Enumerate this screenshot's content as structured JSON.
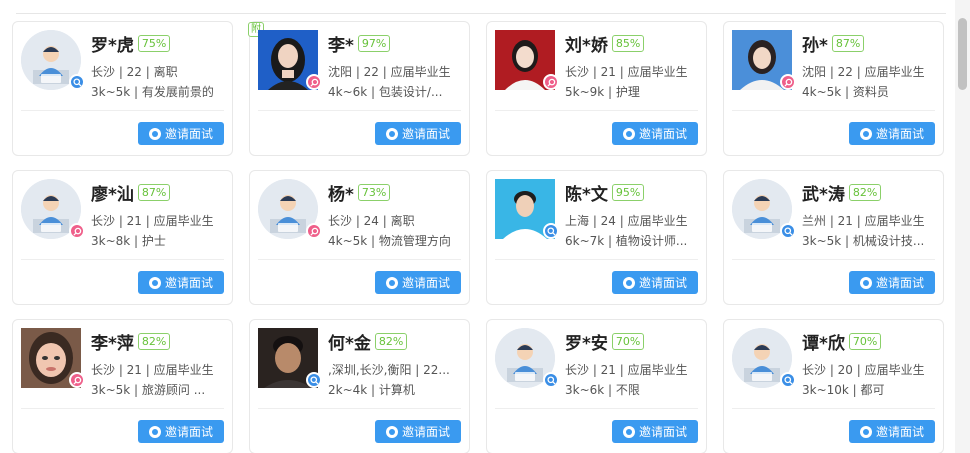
{
  "invite_label": "邀请面试",
  "attachment_label": "附",
  "colors": {
    "accent": "#3a9af0",
    "match_green": "#67c23a",
    "status_blue": "#3a8ee6",
    "status_pink": "#ef5f8a"
  },
  "candidates": [
    {
      "name": "罗*虎",
      "match": "75%",
      "info": "长沙 | 22 | 离职",
      "detail": "3k~5k | 有发展前景的",
      "avatar": "default",
      "status": "blue",
      "attachment": false
    },
    {
      "name": "李*",
      "match": "97%",
      "info": "沈阳 | 22 | 应届毕业生",
      "detail": "4k~6k | 包装设计/...",
      "avatar": "photo-woman-dark-hair-blue-bg",
      "status": "pink",
      "attachment": true
    },
    {
      "name": "刘*娇",
      "match": "85%",
      "info": "长沙 | 21 | 应届毕业生",
      "detail": "5k~9k | 护理",
      "avatar": "photo-woman-red-bg",
      "status": "pink",
      "attachment": false
    },
    {
      "name": "孙*",
      "match": "87%",
      "info": "沈阳 | 22 | 应届毕业生",
      "detail": "4k~5k | 资料员",
      "avatar": "photo-woman-blue-bg",
      "status": "pink",
      "attachment": false
    },
    {
      "name": "廖*汕",
      "match": "87%",
      "info": "长沙 | 21 | 应届毕业生",
      "detail": "3k~8k | 护士",
      "avatar": "default",
      "status": "pink",
      "attachment": false
    },
    {
      "name": "杨*",
      "match": "73%",
      "info": "长沙 | 24 | 离职",
      "detail": "4k~5k | 物流管理方向",
      "avatar": "default",
      "status": "pink",
      "attachment": false
    },
    {
      "name": "陈*文",
      "match": "95%",
      "info": "上海 | 24 | 应届毕业生",
      "detail": "6k~7k | 植物设计师...",
      "avatar": "photo-man-cyan-bg",
      "status": "blue",
      "attachment": false
    },
    {
      "name": "武*涛",
      "match": "82%",
      "info": "兰州 | 21 | 应届毕业生",
      "detail": "3k~5k | 机械设计技...",
      "avatar": "default",
      "status": "blue",
      "attachment": false
    },
    {
      "name": "李*萍",
      "match": "82%",
      "info": "长沙 | 21 | 应届毕业生",
      "detail": "3k~5k | 旅游顾问 ...",
      "avatar": "photo-woman-face",
      "status": "pink",
      "attachment": false
    },
    {
      "name": "何*金",
      "match": "82%",
      "info": ",深圳,长沙,衡阳 | 22...",
      "detail": "2k~4k | 计算机",
      "avatar": "photo-man-dark",
      "status": "blue",
      "attachment": false
    },
    {
      "name": "罗*安",
      "match": "70%",
      "info": "长沙 | 21 | 应届毕业生",
      "detail": "3k~6k | 不限",
      "avatar": "default",
      "status": "blue",
      "attachment": false
    },
    {
      "name": "谭*欣",
      "match": "70%",
      "info": "长沙 | 20 | 应届毕业生",
      "detail": "3k~10k | 都可",
      "avatar": "default",
      "status": "blue",
      "attachment": false
    }
  ]
}
